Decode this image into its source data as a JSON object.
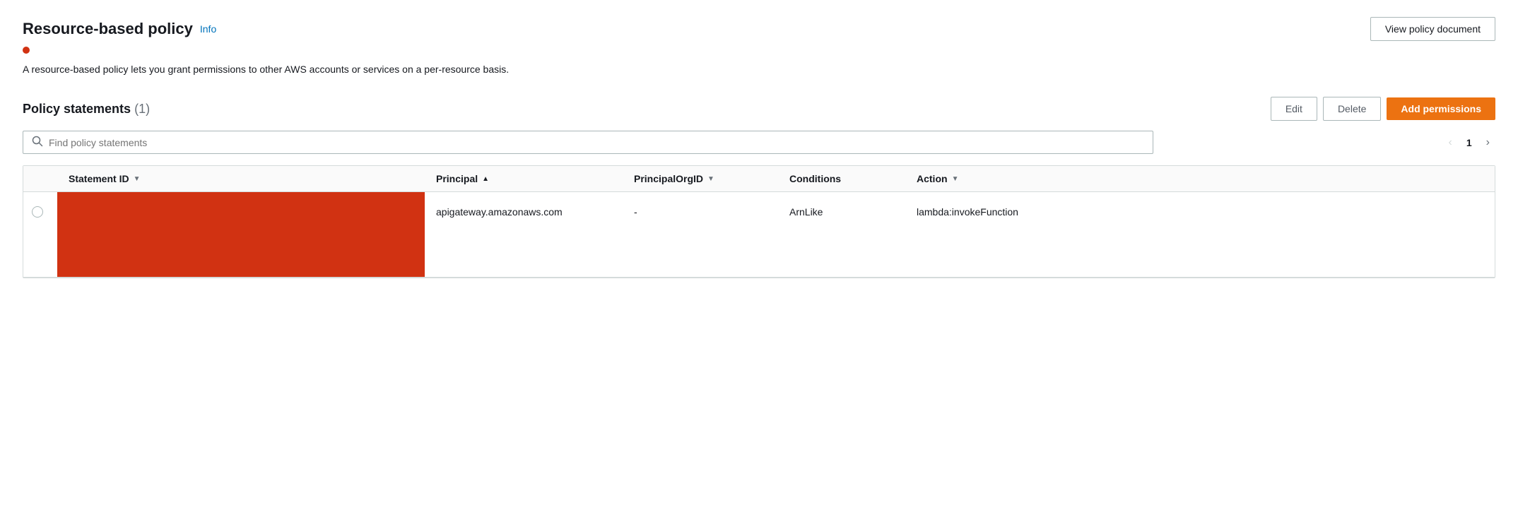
{
  "header": {
    "title": "Resource-based policy",
    "info_label": "Info",
    "view_policy_btn": "View policy document"
  },
  "red_dot_visible": true,
  "description": "A resource-based policy lets you grant permissions to other AWS accounts or services on a per-resource basis.",
  "policy_statements": {
    "title": "Policy statements",
    "count": "(1)",
    "edit_btn": "Edit",
    "delete_btn": "Delete",
    "add_permissions_btn": "Add permissions",
    "search_placeholder": "Find policy statements",
    "pagination": {
      "current_page": 1
    },
    "table": {
      "columns": [
        {
          "label": "Statement ID",
          "sort": "down"
        },
        {
          "label": "Principal",
          "sort": "up"
        },
        {
          "label": "PrincipalOrgID",
          "sort": "down"
        },
        {
          "label": "Conditions",
          "sort": "none"
        },
        {
          "label": "Action",
          "sort": "down"
        }
      ],
      "rows": [
        {
          "statement_id": "",
          "statement_id_redacted": true,
          "principal": "apigateway.amazonaws.com",
          "principal_org_id": "-",
          "conditions": "ArnLike",
          "action": "lambda:invokeFunction"
        }
      ]
    }
  },
  "icons": {
    "search": "🔍",
    "chevron_left": "‹",
    "chevron_right": "›",
    "sort_down": "▼",
    "sort_up": "▲"
  }
}
